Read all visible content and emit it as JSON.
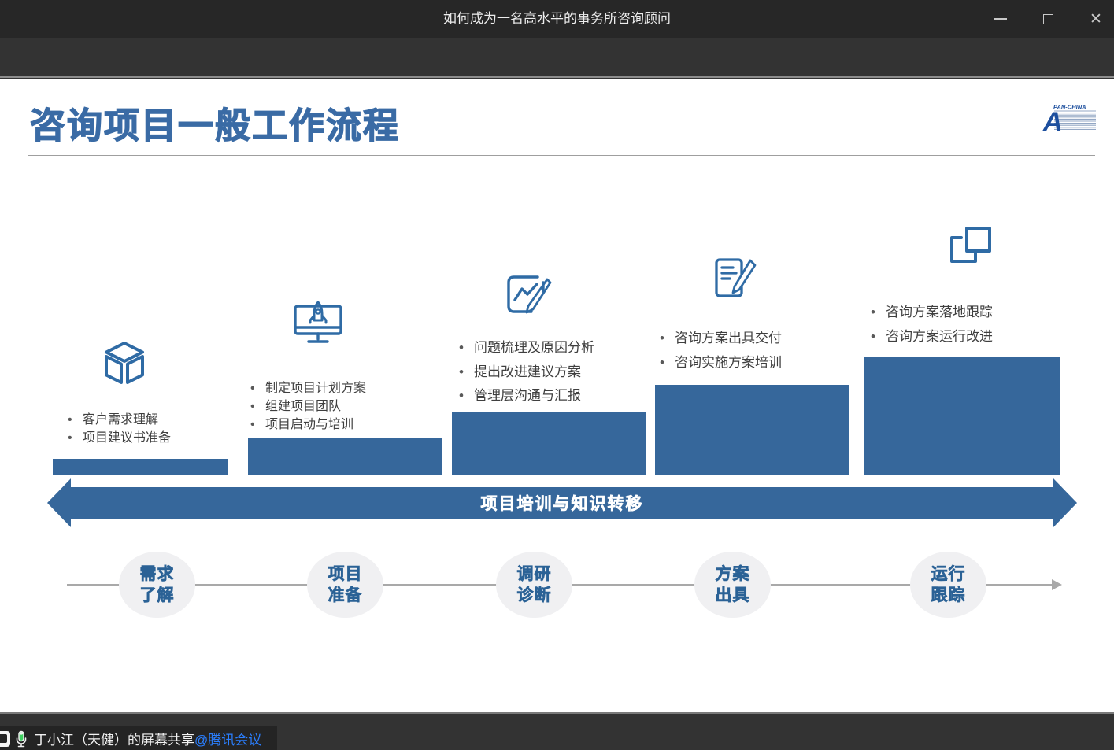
{
  "window": {
    "title": "如何成为一名高水平的事务所咨询顾问",
    "close_glyph": "✕"
  },
  "slide": {
    "title": "咨询项目一般工作流程",
    "logo": {
      "brand": "PAN-CHINA",
      "letter": "A"
    },
    "banner": "项目培训与知识转移",
    "stages": [
      {
        "name": "需求了解",
        "icon": "cube-icon",
        "bullets": [
          "客户需求理解",
          "项目建议书准备"
        ],
        "circle": [
          "需求",
          "了解"
        ]
      },
      {
        "name": "项目准备",
        "icon": "monitor-rocket-icon",
        "bullets": [
          "制定项目计划方案",
          "组建项目团队",
          "项目启动与培训"
        ],
        "circle": [
          "项目",
          "准备"
        ]
      },
      {
        "name": "调研诊断",
        "icon": "chart-pencil-icon",
        "bullets": [
          "问题梳理及原因分析",
          "提出改进建议方案",
          "管理层沟通与汇报"
        ],
        "circle": [
          "调研",
          "诊断"
        ]
      },
      {
        "name": "方案出具",
        "icon": "document-pencil-icon",
        "bullets": [
          "咨询方案出具交付",
          "咨询实施方案培训"
        ],
        "circle": [
          "方案",
          "出具"
        ]
      },
      {
        "name": "运行跟踪",
        "icon": "overlapping-squares-icon",
        "bullets": [
          "咨询方案落地跟踪",
          "咨询方案运行改进"
        ],
        "circle": [
          "运行",
          "跟踪"
        ]
      }
    ]
  },
  "share_bar": {
    "speaker": "丁小江（天健）的屏幕共享",
    "meeting_link": "@腾讯会议"
  },
  "colors": {
    "accent_blue": "#36679B",
    "title_blue": "#3A6BA5",
    "logo_blue": "#1d4f9e",
    "link_blue": "#2B7FFF",
    "mic_green": "#3ED160",
    "node_bg": "#f0f0f2"
  }
}
